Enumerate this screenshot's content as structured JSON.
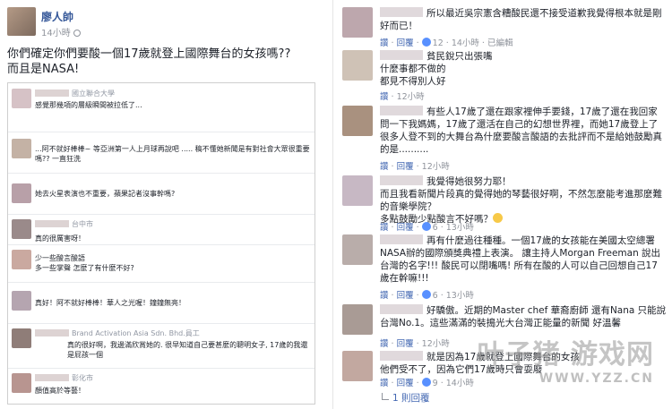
{
  "post": {
    "author": "廖人帥",
    "time": "14小時",
    "line1": "你們確定你們要酸一個17歲就登上國際舞台的女孩嗎??",
    "line2": "而且是NASA!"
  },
  "embed_comments": [
    {
      "who": "國立聯合大學",
      "text": "感覺那幾項的層級瞬間被拉低了..."
    },
    {
      "who": "",
      "text": "...阿不就好棒棒~ 等亞洲第一人上月球再說吧 .....  稿不懂她新聞是有對社會大眾很重要嗎?? 一直狂洗"
    },
    {
      "who": "",
      "text": "她去火星表演也不重要，蘋果記者沒事幹嗎?"
    },
    {
      "who": "台中市",
      "text": "真的很厲害呀！"
    },
    {
      "who": "",
      "text": "少一些酸言酸語\n多一些掌聲 怎麼了有什麼不好?"
    },
    {
      "who": "",
      "text": "真好！阿不就好棒棒！華人之光喔！鐘鐘無亮！"
    },
    {
      "who": "Brand Activation Asia Sdn. Bhd.員工",
      "text": "真的很好啊，我邊滿欣賞她的. 很早知道自己要甚麼的聰明女子, 17歲的我還是屁孩一個"
    },
    {
      "who": "彰化市",
      "text": "顏值高於等藝！"
    }
  ],
  "right_comments": [
    {
      "text": "所以最近吳宗憲含糟酸民還不接受道歉我覺得根本就是剛好而已！",
      "like": "讚",
      "reply": "回覆",
      "likes": "12",
      "time": "14小時",
      "edited": "已編輯"
    },
    {
      "text": "貧民銳只出張嘴\n什麼事都不做的\n都見不得別人好",
      "like": "讚",
      "reply": "",
      "likes": "",
      "time": "12小時",
      "edited": ""
    },
    {
      "text": "有些人17歲了還在跟家裡伸手要錢，17歲了還在我回家問一下我媽媽，17歲了還活在自己的幻想世界裡，而她17歲登上了很多人登不到的大舞台為什麼要酸言酸語的去批評而不是給她鼓勵真的是..........",
      "like": "讚",
      "reply": "回覆",
      "likes": "",
      "time": "12小時",
      "edited": ""
    },
    {
      "text": "我覺得她很努力耶！\n而且我看新聞片段真的覺得她的琴藝很好啊，不然怎麼能考進那麼難的音樂學院？\n多點鼓勵少點酸言不好嗎？",
      "like": "讚",
      "reply": "回覆",
      "likes": "6",
      "time": "13小時",
      "edited": ""
    },
    {
      "text": "再有什麼過往種種。一個17歲的女孩能在美國太空總署NASA辦的國際頒獎典禮上表演。 讓主持人Morgan Freeman 說出台灣的名字!!! 酸民可以閉嘴嗎! 所有在酸的人可以自己回想自己17歲在幹嘛!!!",
      "like": "讚",
      "reply": "回覆",
      "likes": "6",
      "time": "13小時",
      "edited": ""
    },
    {
      "text": "好驕傲。近期的Master chef 華裔廚師 還有Nana 只能說台灣No.1。這些滿滿的裝搗光大台灣正能量的新聞 好溫馨",
      "like": "讚",
      "reply": "回覆",
      "likes": "",
      "time": "12小時",
      "edited": ""
    },
    {
      "text": "就是因為17歲就登上國際舞台的女孩\n他們受不了，因為它們17歲時只會耍廢",
      "like": "讚",
      "reply": "回覆",
      "likes": "9",
      "time": "14小時",
      "edited": ""
    }
  ],
  "replies_link": "1 則回覆",
  "watermark": {
    "brand": "叶子猪 游戏网",
    "url": "WWW.YZZ.CN"
  }
}
